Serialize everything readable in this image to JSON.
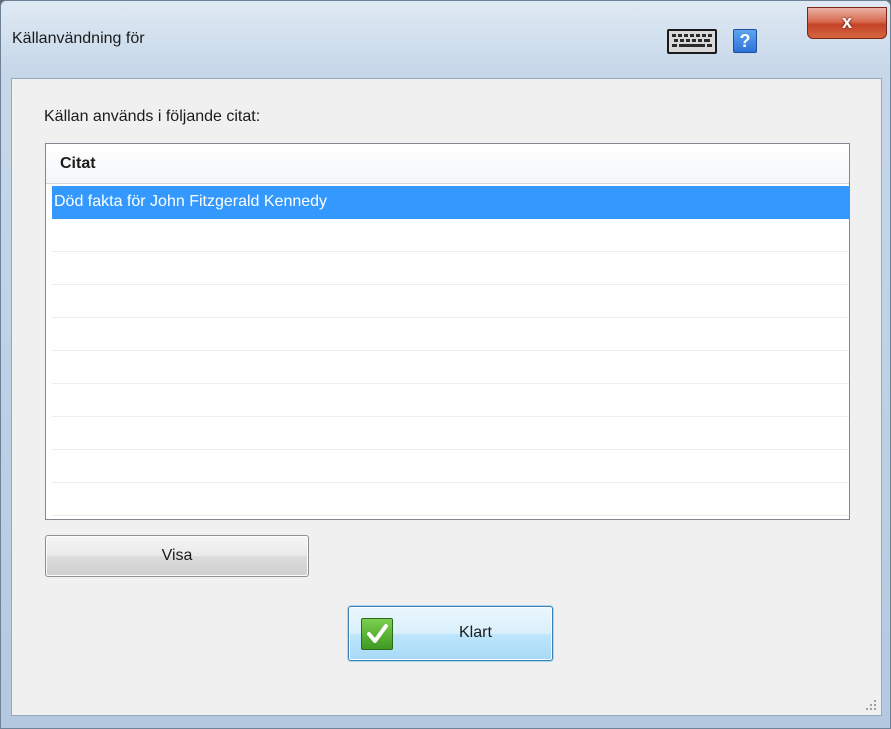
{
  "window": {
    "title": "Källanvändning för",
    "close_label": "x"
  },
  "titlebar": {
    "help_label": "?"
  },
  "content": {
    "prompt": "Källan används i följande citat:",
    "list": {
      "column_header": "Citat",
      "rows": [
        {
          "text": "Död fakta för John Fitzgerald Kennedy",
          "selected": true
        }
      ]
    },
    "visa_label": "Visa",
    "klart_label": "Klart"
  },
  "colors": {
    "selection": "#3399ff",
    "close_button": "#c4432a",
    "check_icon": "#3f9a22"
  },
  "icons": [
    "keyboard-icon",
    "help-icon",
    "close-icon",
    "checkmark-icon",
    "resize-grip-icon"
  ]
}
